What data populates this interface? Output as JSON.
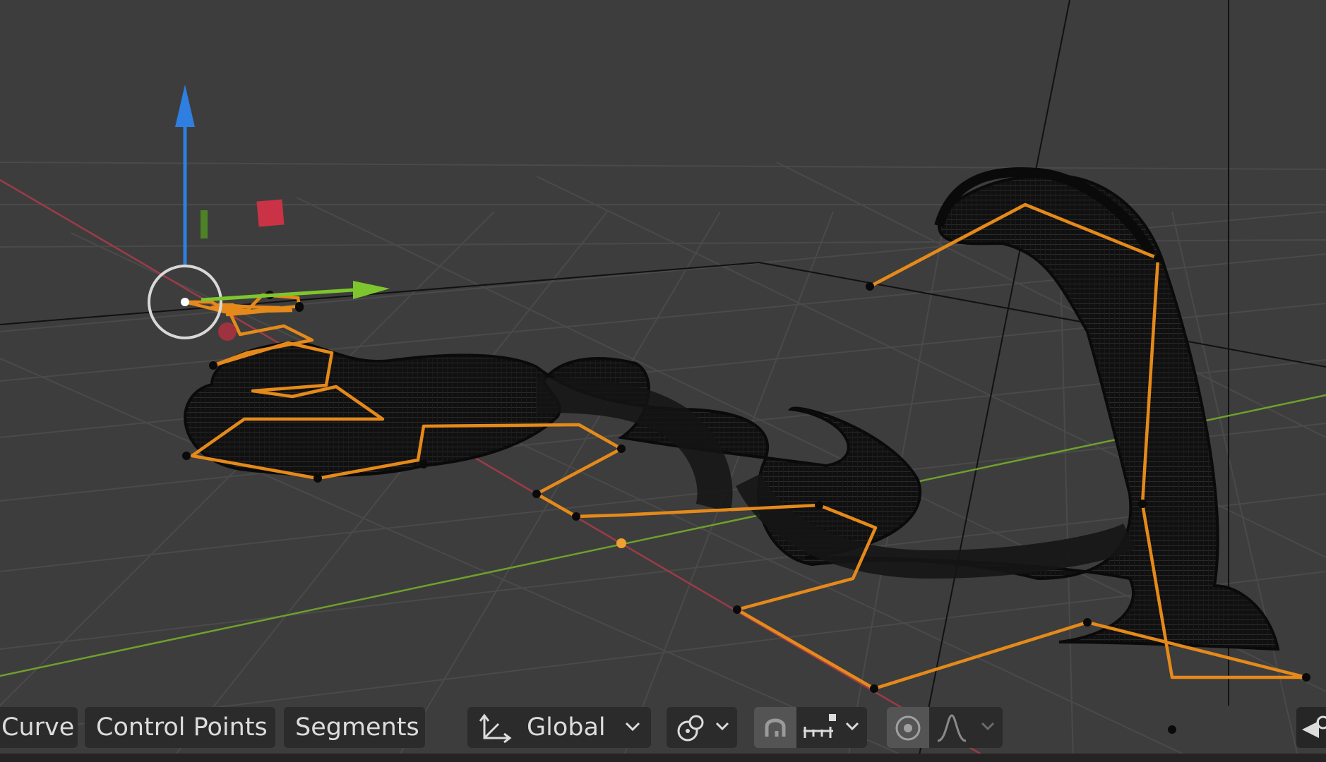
{
  "header": {
    "menu_curve": "Curve",
    "menu_control_points": "Control Points",
    "menu_segments": "Segments",
    "orientation_label": "Global"
  },
  "icons": {
    "orientation": "transform-orientation-icon",
    "pivot": "pivot-point-icon",
    "snap": "snap-magnet-icon",
    "snap_increment": "snap-increment-icon",
    "proportional": "proportional-editing-icon",
    "falloff": "falloff-curve-icon",
    "view_camera": "camera-view-icon"
  },
  "colors": {
    "viewport_bg": "#3d3d3d",
    "grid_line": "#4a4a4a",
    "x_axis": "#9c3b48",
    "y_axis": "#6fa02c",
    "gizmo_z": "#2f7fe0",
    "gizmo_y": "#7ec62d",
    "gizmo_x": "#d8354a",
    "curve_selected": "#e58a1a",
    "mesh_wire": "#0b0b0b"
  }
}
